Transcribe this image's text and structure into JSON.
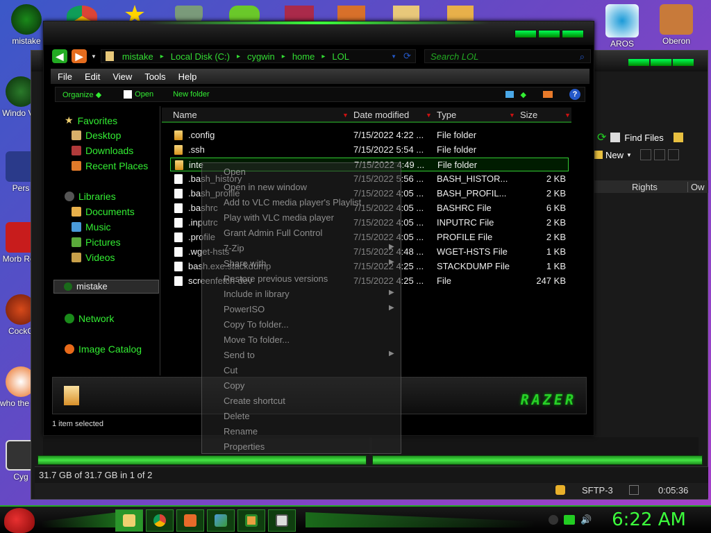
{
  "desktop": {
    "icons_left": [
      {
        "label": "mistake",
        "color": "#1a8a1a"
      },
      {
        "label": "Windo Vis",
        "color": "#2a7a2a"
      },
      {
        "label": "Pers",
        "color": "#2a3a8a"
      },
      {
        "label": "Morb Rea",
        "color": "#c81c1c"
      },
      {
        "label": "CockC",
        "color": "#d84a1a"
      },
      {
        "label": "who the uses",
        "color": "#e86a1a"
      },
      {
        "label": "Cyg",
        "color": "#333333"
      }
    ],
    "icons_right": [
      {
        "label": "AROS",
        "color": "#1a9ad8"
      },
      {
        "label": "Oberon",
        "color": "#c87a3a"
      }
    ]
  },
  "back_window": {
    "find_files": "Find Files",
    "new_label": "New",
    "rights_col": "Rights",
    "owner_col": "Ow",
    "status_left": "31.7 GB of 31.7 GB in 1 of 2",
    "sftp_label": "SFTP-3",
    "timer": "0:05:36"
  },
  "explorer": {
    "breadcrumbs": [
      "mistake",
      "Local Disk (C:)",
      "cygwin",
      "home",
      "LOL"
    ],
    "search_placeholder": "Search LOL",
    "menu": [
      "File",
      "Edit",
      "View",
      "Tools",
      "Help"
    ],
    "commands": {
      "organize": "Organize",
      "open": "Open",
      "new_folder": "New folder"
    },
    "nav": {
      "favorites": "Favorites",
      "desktop": "Desktop",
      "downloads": "Downloads",
      "recent": "Recent Places",
      "libraries": "Libraries",
      "documents": "Documents",
      "music": "Music",
      "pictures": "Pictures",
      "videos": "Videos",
      "drive": "mistake",
      "network": "Network",
      "image_catalog": "Image Catalog"
    },
    "columns": {
      "name": "Name",
      "date": "Date modified",
      "type": "Type",
      "size": "Size"
    },
    "files": [
      {
        "name": ".config",
        "date": "7/15/2022 4:22 ...",
        "type": "File folder",
        "size": "",
        "kind": "folder"
      },
      {
        "name": ".ssh",
        "date": "7/15/2022 5:54 ...",
        "type": "File folder",
        "size": "",
        "kind": "folder"
      },
      {
        "name": "inte",
        "date": "7/15/2022 4:49 ...",
        "type": "File folder",
        "size": "",
        "kind": "folder",
        "selected": true
      },
      {
        "name": ".bash_history",
        "date": "7/15/2022 5:56 ...",
        "type": "BASH_HISTOR...",
        "size": "2 KB",
        "kind": "doc"
      },
      {
        "name": ".bash_profile",
        "date": "7/15/2022 4:05 ...",
        "type": "BASH_PROFIL...",
        "size": "2 KB",
        "kind": "doc"
      },
      {
        "name": ".bashrc",
        "date": "7/15/2022 4:05 ...",
        "type": "BASHRC File",
        "size": "6 KB",
        "kind": "doc"
      },
      {
        "name": ".inputrc",
        "date": "7/15/2022 4:05 ...",
        "type": "INPUTRC File",
        "size": "2 KB",
        "kind": "doc"
      },
      {
        "name": ".profile",
        "date": "7/15/2022 4:05 ...",
        "type": "PROFILE File",
        "size": "2 KB",
        "kind": "doc"
      },
      {
        "name": ".wget-hsts",
        "date": "7/15/2022 4:48 ...",
        "type": "WGET-HSTS File",
        "size": "1 KB",
        "kind": "doc"
      },
      {
        "name": "bash.exe.stackdump",
        "date": "7/15/2022 4:25 ...",
        "type": "STACKDUMP File",
        "size": "1 KB",
        "kind": "doc"
      },
      {
        "name": "screenfetch-dev",
        "date": "7/15/2022 4:25 ...",
        "type": "File",
        "size": "247 KB",
        "kind": "doc"
      }
    ],
    "brand": "RAZER",
    "status": "1 item selected"
  },
  "context_menu": [
    {
      "label": "Open",
      "submenu": false
    },
    {
      "label": "Open in new window",
      "submenu": false
    },
    {
      "label": "Add to VLC media player's Playlist",
      "submenu": false
    },
    {
      "label": "Play with VLC media player",
      "submenu": false
    },
    {
      "label": "Grant Admin Full Control",
      "submenu": false
    },
    {
      "label": "7-Zip",
      "submenu": true
    },
    {
      "label": "Share with",
      "submenu": true
    },
    {
      "label": "Restore previous versions",
      "submenu": false
    },
    {
      "label": "Include in library",
      "submenu": true
    },
    {
      "label": "PowerISO",
      "submenu": true
    },
    {
      "label": "Copy To folder...",
      "submenu": false
    },
    {
      "label": "Move To folder...",
      "submenu": false
    },
    {
      "label": "Send to",
      "submenu": true
    },
    {
      "label": "Cut",
      "submenu": false
    },
    {
      "label": "Copy",
      "submenu": false
    },
    {
      "label": "Create shortcut",
      "submenu": false
    },
    {
      "label": "Delete",
      "submenu": false
    },
    {
      "label": "Rename",
      "submenu": false
    },
    {
      "label": "Properties",
      "submenu": false
    }
  ],
  "taskbar": {
    "clock": "6:22 AM",
    "accent": "#3cff3c"
  }
}
